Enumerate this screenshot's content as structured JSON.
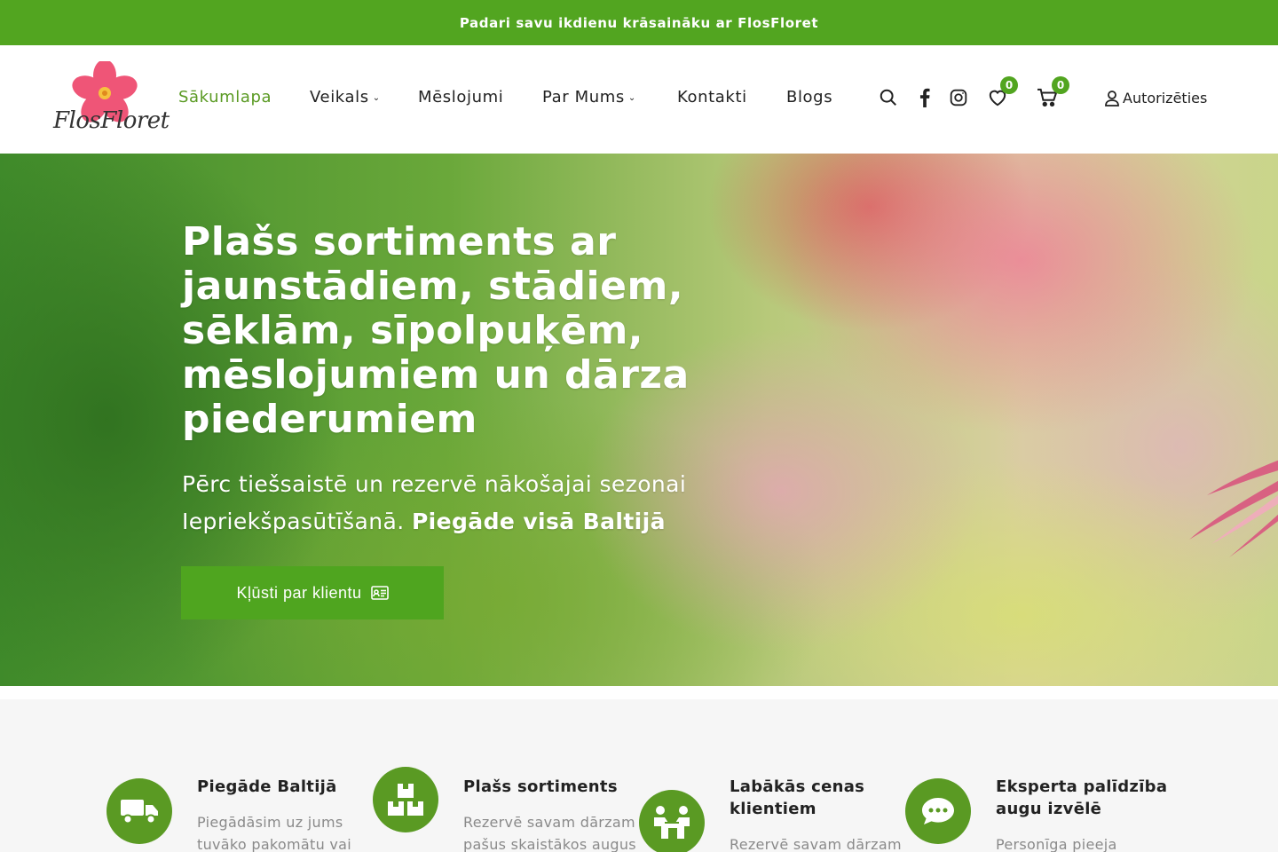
{
  "topbar": {
    "text": "Padari savu ikdienu krāsaināku ar FlosFloret"
  },
  "header": {
    "logo_text": "FlosFloret",
    "nav": [
      {
        "label": "Sākumlapa",
        "active": true
      },
      {
        "label": "Veikals",
        "dropdown": true
      },
      {
        "label": "Mēslojumi"
      },
      {
        "label": "Par Mums",
        "dropdown": true
      },
      {
        "label": "Kontakti"
      },
      {
        "label": "Blogs"
      }
    ],
    "icons": [
      "search-icon",
      "facebook-icon",
      "instagram-icon",
      "heart-icon",
      "cart-icon",
      "user-icon"
    ],
    "wishlist_count": "0",
    "cart_count": "0",
    "login_label": "Autorizēties"
  },
  "hero": {
    "title": "Plašs sortiments ar jaunstādiem, stādiem, sēklām, sīpolpuķēm, mēslojumiem un dārza piederumiem",
    "subtitle_line1": "Pērc tiešsaistē un rezervē nākošajai sezonai",
    "subtitle_line2_regular": "Iepriekšpasūtīšanā.",
    "subtitle_line2_bold": "Piegāde visā Baltijā",
    "cta_label": "Kļūsti par klientu"
  },
  "features": [
    {
      "icon": "truck-icon",
      "title": "Piegāde Baltijā",
      "text": "Piegādāsim uz jums tuvāko pakomātu vai"
    },
    {
      "icon": "boxes-icon",
      "title": "Plašs sortiments",
      "text": "Rezervē savam dārzam pašus skaistākos augus"
    },
    {
      "icon": "handshake-icon",
      "title": "Labākās cenas klientiem",
      "text": "Rezervē savam dārzam"
    },
    {
      "icon": "chat-icon",
      "title": "Eksperta palīdzība augu izvēlē",
      "text": "Personīga pieeja katram"
    }
  ],
  "colors": {
    "brand_green": "#52a520",
    "icon_green": "#5a9a23",
    "active_nav": "#5a9a23"
  }
}
